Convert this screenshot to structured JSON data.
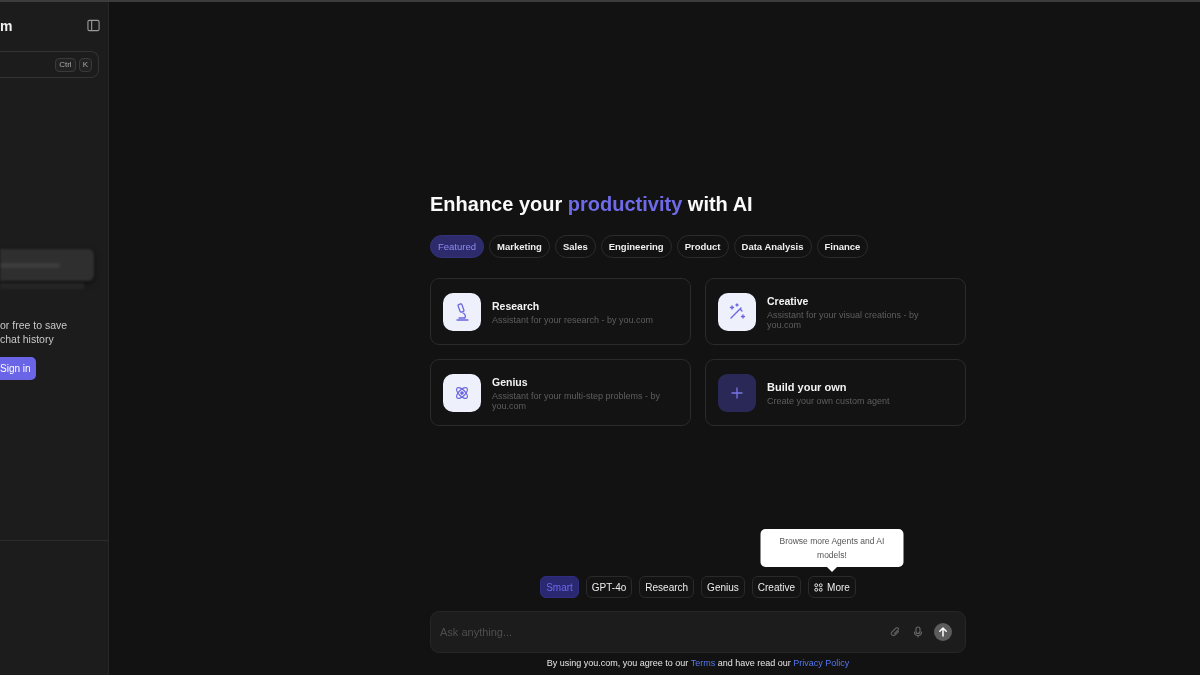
{
  "sidebar": {
    "brand": "m",
    "search": {
      "shortcut_keys": [
        "Ctrl",
        "K"
      ]
    },
    "signup_text": "or free to save\nchat history",
    "sign_in_button": "Sign in"
  },
  "heading": {
    "before": "Enhance your",
    "highlight": "productivity",
    "after": "with AI"
  },
  "categories": [
    {
      "label": "Featured",
      "selected": true
    },
    {
      "label": "Marketing",
      "selected": false
    },
    {
      "label": "Sales",
      "selected": false
    },
    {
      "label": "Engineering",
      "selected": false
    },
    {
      "label": "Product",
      "selected": false
    },
    {
      "label": "Data Analysis",
      "selected": false
    },
    {
      "label": "Finance",
      "selected": false
    }
  ],
  "agents": [
    {
      "kind": "assistant",
      "title": "Research",
      "description": "Assistant for your research - by you.com"
    },
    {
      "kind": "assistant",
      "title": "Creative",
      "description": "Assistant for your visual creations - by you.com"
    },
    {
      "kind": "assistant",
      "title": "Genius",
      "description": "Assistant for your multi-step problems - by you.com"
    },
    {
      "kind": "create",
      "title": "Build your own",
      "description": "Create your own custom agent"
    }
  ],
  "models": [
    {
      "kind": "model",
      "label": "Smart",
      "selected": true
    },
    {
      "kind": "model",
      "label": "GPT-4o",
      "selected": false
    },
    {
      "kind": "model",
      "label": "Research",
      "selected": false
    },
    {
      "kind": "model",
      "label": "Genius",
      "selected": false
    },
    {
      "kind": "model",
      "label": "Creative",
      "selected": false
    },
    {
      "kind": "menu",
      "label": "More",
      "selected": false
    }
  ],
  "tooltip": {
    "text": "Browse more Agents and AI models!"
  },
  "prompt": {
    "placeholder": "Ask anything..."
  },
  "footer": {
    "parts": [
      {
        "kind": "text",
        "text": "By using you.com, you agree to our"
      },
      {
        "kind": "link",
        "text": "Terms"
      },
      {
        "kind": "text",
        "text": "and have read our"
      },
      {
        "kind": "link",
        "text": "Privacy Policy"
      }
    ]
  }
}
